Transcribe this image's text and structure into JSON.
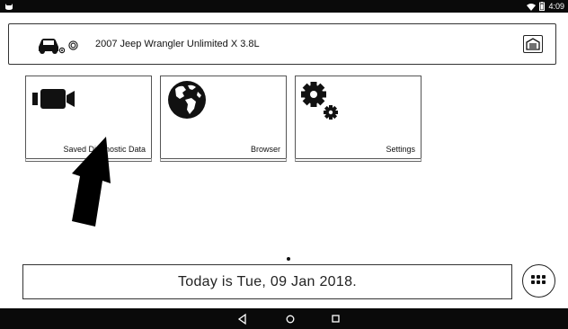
{
  "status_bar": {
    "left_icon": "cat-icon",
    "wifi_icon": "wifi-icon",
    "battery_icon": "battery-icon",
    "time": "4:09"
  },
  "vehicle": {
    "icon": "car-icon",
    "name": "2007 Jeep Wrangler Unlimited X 3.8L",
    "garage_icon": "garage-icon"
  },
  "tiles": [
    {
      "label": "Saved Diagnostic Data",
      "icon": "video-camera-icon"
    },
    {
      "label": "Browser",
      "icon": "globe-icon"
    },
    {
      "label": "Settings",
      "icon": "gears-icon"
    }
  ],
  "arrow_icon": "arrow-up-icon",
  "date_text": "Today is Tue, 09 Jan 2018.",
  "apps_icon": "apps-grid-icon",
  "nav": {
    "back_icon": "back-icon",
    "home_icon": "home-icon",
    "recents_icon": "recents-icon"
  },
  "colors": {
    "bar_background": "#0a0a0a",
    "page_background": "#ffffff",
    "border": "#333333"
  }
}
